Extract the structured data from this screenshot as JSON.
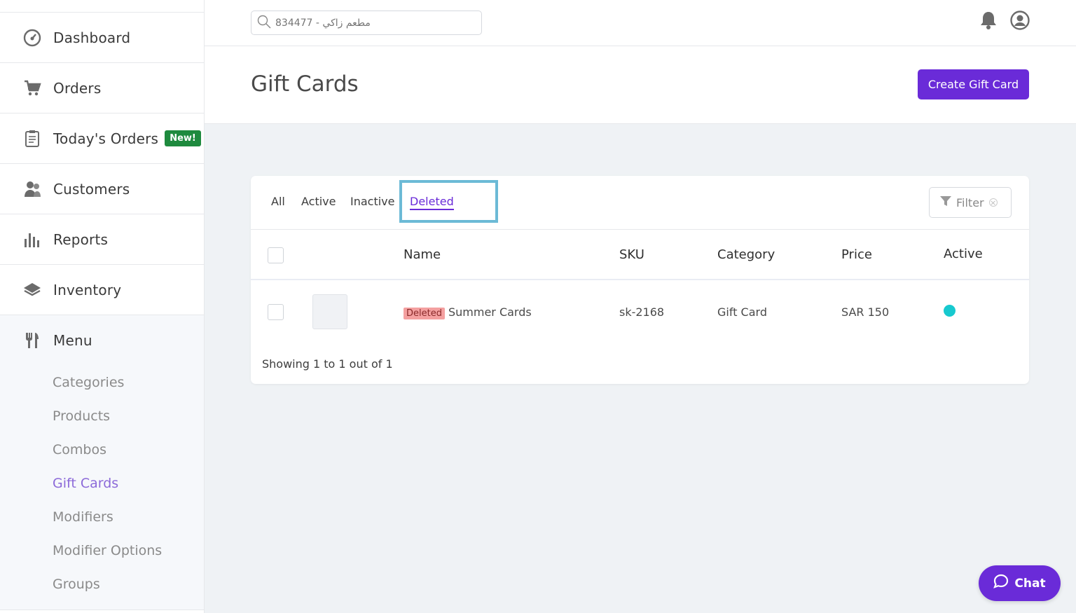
{
  "sidebar": {
    "items": [
      {
        "label": "Dashboard",
        "icon": "dashboard-gauge-icon"
      },
      {
        "label": "Orders",
        "icon": "cart-icon"
      },
      {
        "label": "Today's Orders",
        "icon": "clipboard-icon",
        "badge": "New!"
      },
      {
        "label": "Customers",
        "icon": "customers-icon"
      },
      {
        "label": "Reports",
        "icon": "bar-chart-icon"
      },
      {
        "label": "Inventory",
        "icon": "layers-icon"
      }
    ],
    "menu": {
      "label": "Menu",
      "icon": "fork-knife-icon",
      "sub_items": [
        "Categories",
        "Products",
        "Combos",
        "Gift Cards",
        "Modifiers",
        "Modifier Options",
        "Groups"
      ],
      "active": "Gift Cards"
    }
  },
  "header": {
    "search_placeholder": "مطعم زاكي - 834477"
  },
  "page": {
    "title": "Gift Cards",
    "create_label": "Create Gift Card"
  },
  "tabs": [
    "All",
    "Active",
    "Inactive",
    "Deleted"
  ],
  "active_tab": "Deleted",
  "filter_label": "Filter",
  "table": {
    "columns": [
      "Name",
      "SKU",
      "Category",
      "Price",
      "Active"
    ],
    "rows": [
      {
        "tag": "Deleted",
        "name": "Summer Cards",
        "sku": "sk-2168",
        "category": "Gift Card",
        "price": "SAR 150",
        "active": true
      }
    ]
  },
  "showing": "Showing 1 to 1 out of 1",
  "chat_label": "Chat",
  "colors": {
    "primary": "#6a2bd8",
    "active_dot": "#17c9cf",
    "new_badge": "#1e8a3e",
    "deleted_tag": "#f4a0a0",
    "highlight": "#6cbad6"
  }
}
